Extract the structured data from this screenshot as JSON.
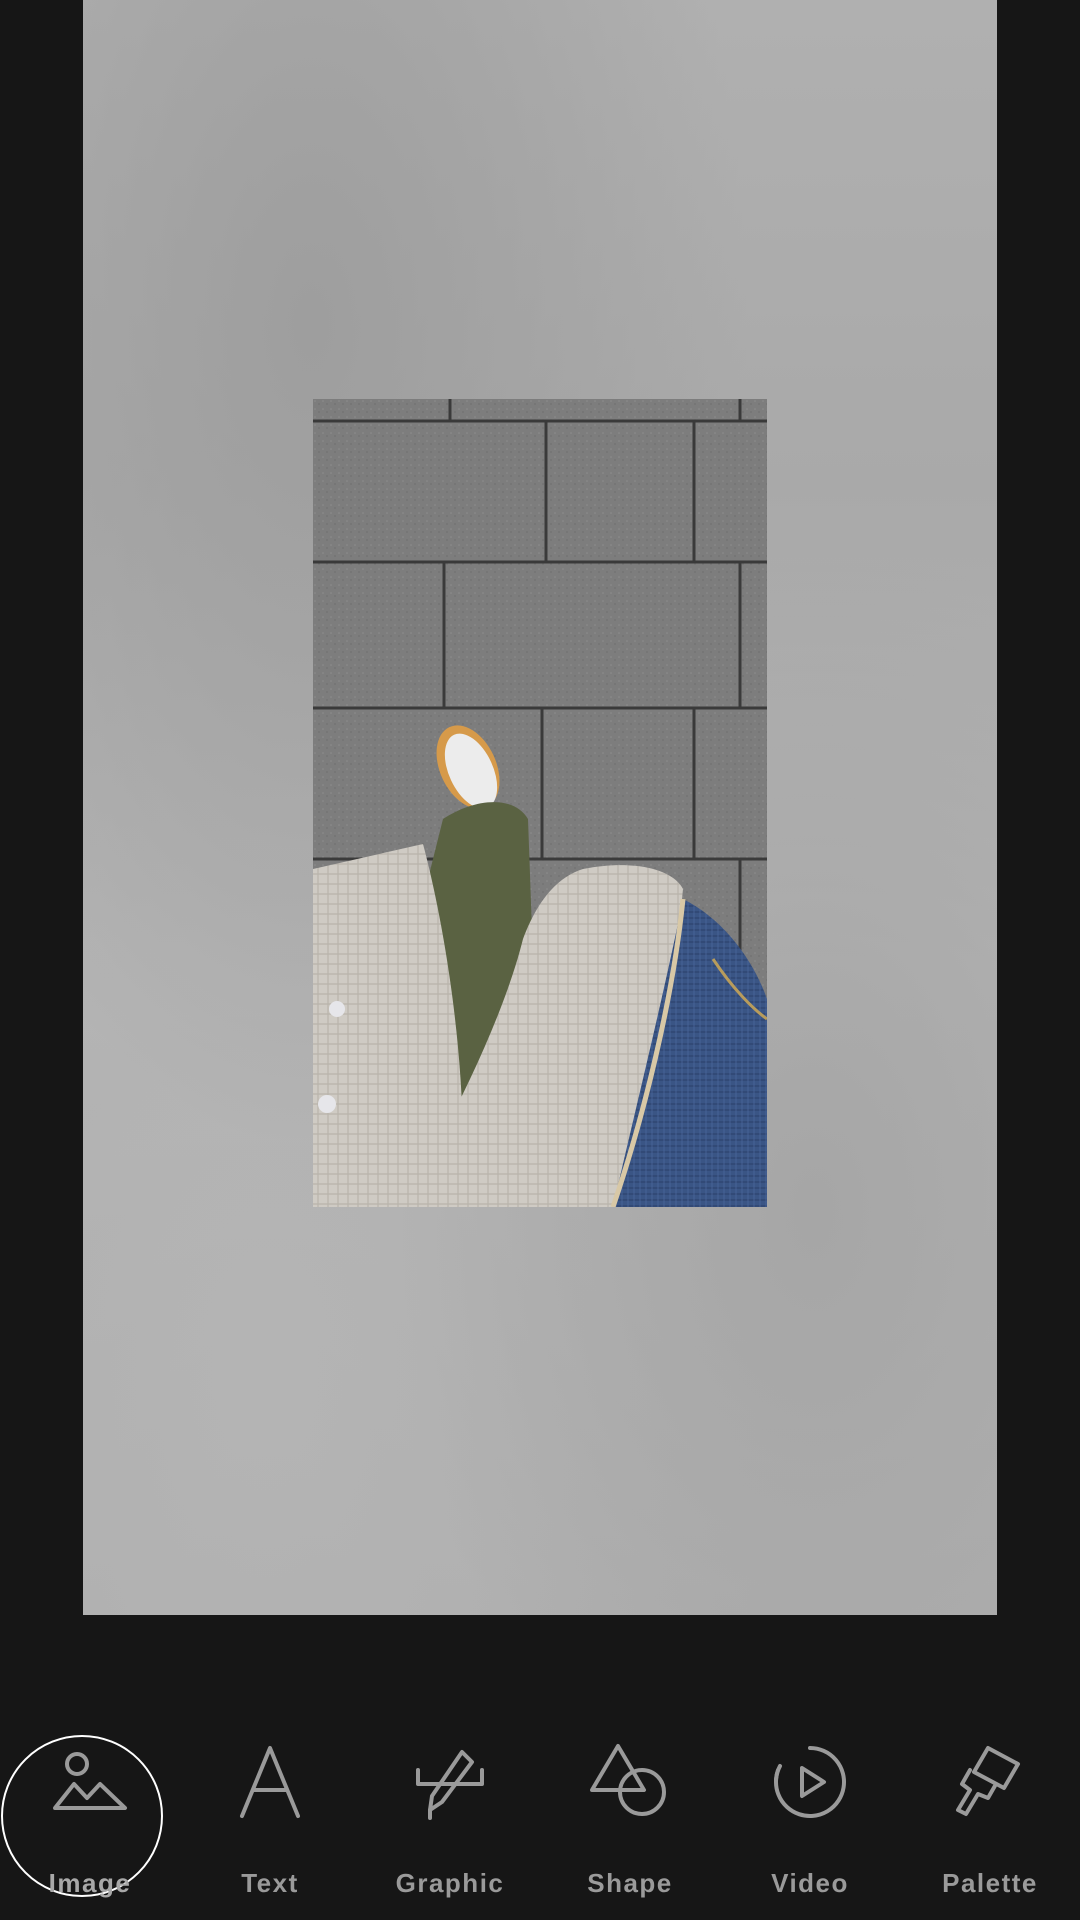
{
  "toolbar": {
    "active_tool": "Image",
    "tools": [
      {
        "id": "image",
        "label": "Image",
        "icon": "image-icon"
      },
      {
        "id": "text",
        "label": "Text",
        "icon": "text-icon"
      },
      {
        "id": "graphic",
        "label": "Graphic",
        "icon": "graphic-icon"
      },
      {
        "id": "shape",
        "label": "Shape",
        "icon": "shape-icon"
      },
      {
        "id": "video",
        "label": "Video",
        "icon": "video-icon"
      },
      {
        "id": "palette",
        "label": "Palette",
        "icon": "palette-icon"
      }
    ]
  },
  "colors": {
    "background": "#161616",
    "icon_stroke": "#9a9a9a",
    "active_ring": "#ffffff"
  }
}
